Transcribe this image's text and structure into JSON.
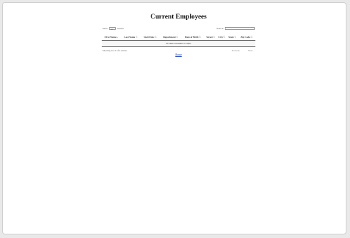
{
  "page": {
    "title": "Current Employees"
  },
  "controls": {
    "show_label": "Show",
    "length_value": "10",
    "entries_label": "entries",
    "search_label": "Search:",
    "search_value": ""
  },
  "table": {
    "columns": [
      "First Name",
      "Last Name",
      "Start Date",
      "Department",
      "Date of Birth",
      "Street",
      "City",
      "State",
      "Zip Code"
    ],
    "empty_message": "No data available in table"
  },
  "footer": {
    "info": "Showing 0 to 0 of 0 entries",
    "previous_label": "Previous",
    "next_label": "Next",
    "home_link": "Home"
  },
  "colors": {
    "link": "#1a3fc4",
    "background": "#ffffff"
  }
}
